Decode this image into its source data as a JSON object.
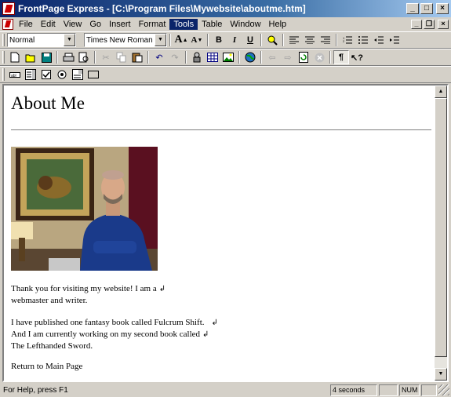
{
  "window": {
    "title": "FrontPage Express - [C:\\Program Files\\Mywebsite\\aboutme.htm]",
    "controls": {
      "minimize": "_",
      "maximize": "□",
      "close": "×"
    }
  },
  "menu": {
    "items": [
      "File",
      "Edit",
      "View",
      "Go",
      "Insert",
      "Format",
      "Tools",
      "Table",
      "Window",
      "Help"
    ],
    "active": "Tools",
    "mdi_controls": {
      "minimize": "_",
      "restore": "❐",
      "close": "×"
    }
  },
  "format_toolbar": {
    "style": "Normal",
    "font": "Times New Roman",
    "buttons": [
      "A",
      "A",
      "B",
      "I",
      "U"
    ]
  },
  "document": {
    "heading": "About Me",
    "para1": [
      "Thank you for visiting my website! I am a",
      "webmaster and writer."
    ],
    "para2": [
      "I have published one fantasy book called Fulcrum Shift.",
      "And I am currently working on my second book called",
      "The Lefthanded Sword."
    ],
    "link": "Return to Main Page",
    "line_break_mark": "↲"
  },
  "status": {
    "help_text": "For Help, press F1",
    "time": "4 seconds",
    "num": "NUM"
  }
}
